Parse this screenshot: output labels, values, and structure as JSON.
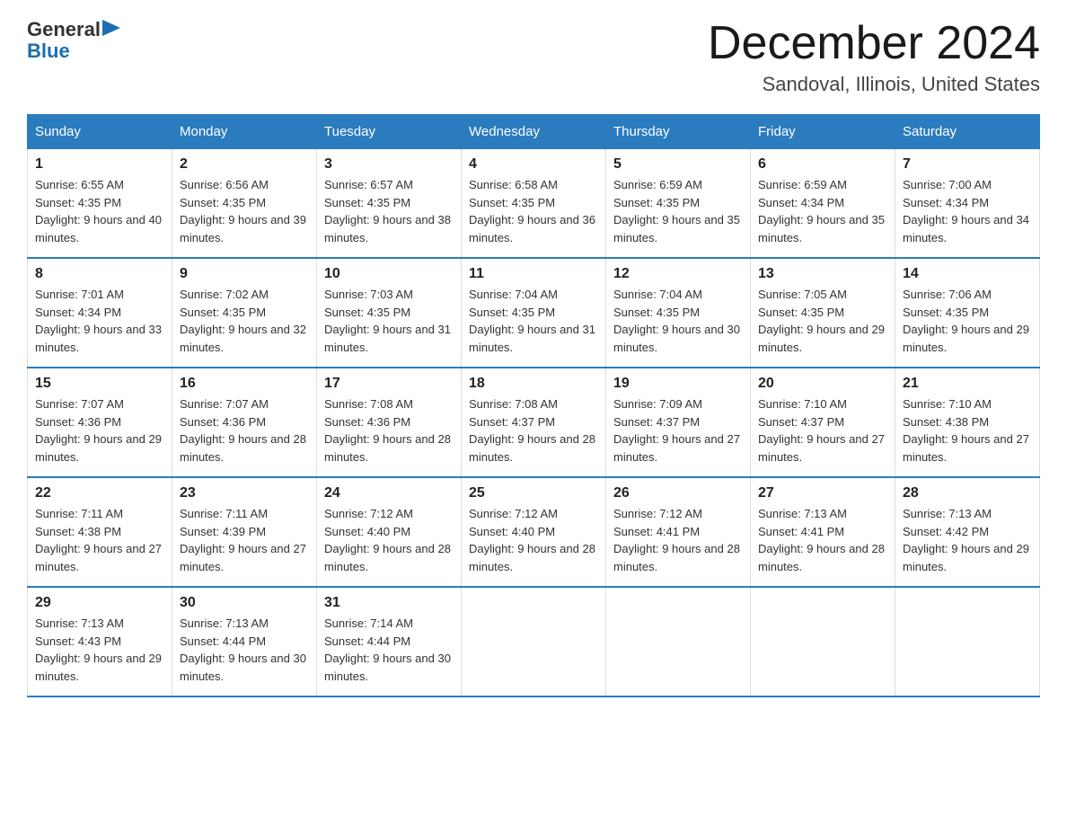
{
  "header": {
    "logo": {
      "general": "General",
      "blue": "Blue",
      "arrow": "▶"
    },
    "title": "December 2024",
    "subtitle": "Sandoval, Illinois, United States"
  },
  "days_of_week": [
    "Sunday",
    "Monday",
    "Tuesday",
    "Wednesday",
    "Thursday",
    "Friday",
    "Saturday"
  ],
  "weeks": [
    [
      {
        "day": "1",
        "sunrise": "6:55 AM",
        "sunset": "4:35 PM",
        "daylight": "9 hours and 40 minutes."
      },
      {
        "day": "2",
        "sunrise": "6:56 AM",
        "sunset": "4:35 PM",
        "daylight": "9 hours and 39 minutes."
      },
      {
        "day": "3",
        "sunrise": "6:57 AM",
        "sunset": "4:35 PM",
        "daylight": "9 hours and 38 minutes."
      },
      {
        "day": "4",
        "sunrise": "6:58 AM",
        "sunset": "4:35 PM",
        "daylight": "9 hours and 36 minutes."
      },
      {
        "day": "5",
        "sunrise": "6:59 AM",
        "sunset": "4:35 PM",
        "daylight": "9 hours and 35 minutes."
      },
      {
        "day": "6",
        "sunrise": "6:59 AM",
        "sunset": "4:34 PM",
        "daylight": "9 hours and 35 minutes."
      },
      {
        "day": "7",
        "sunrise": "7:00 AM",
        "sunset": "4:34 PM",
        "daylight": "9 hours and 34 minutes."
      }
    ],
    [
      {
        "day": "8",
        "sunrise": "7:01 AM",
        "sunset": "4:34 PM",
        "daylight": "9 hours and 33 minutes."
      },
      {
        "day": "9",
        "sunrise": "7:02 AM",
        "sunset": "4:35 PM",
        "daylight": "9 hours and 32 minutes."
      },
      {
        "day": "10",
        "sunrise": "7:03 AM",
        "sunset": "4:35 PM",
        "daylight": "9 hours and 31 minutes."
      },
      {
        "day": "11",
        "sunrise": "7:04 AM",
        "sunset": "4:35 PM",
        "daylight": "9 hours and 31 minutes."
      },
      {
        "day": "12",
        "sunrise": "7:04 AM",
        "sunset": "4:35 PM",
        "daylight": "9 hours and 30 minutes."
      },
      {
        "day": "13",
        "sunrise": "7:05 AM",
        "sunset": "4:35 PM",
        "daylight": "9 hours and 29 minutes."
      },
      {
        "day": "14",
        "sunrise": "7:06 AM",
        "sunset": "4:35 PM",
        "daylight": "9 hours and 29 minutes."
      }
    ],
    [
      {
        "day": "15",
        "sunrise": "7:07 AM",
        "sunset": "4:36 PM",
        "daylight": "9 hours and 29 minutes."
      },
      {
        "day": "16",
        "sunrise": "7:07 AM",
        "sunset": "4:36 PM",
        "daylight": "9 hours and 28 minutes."
      },
      {
        "day": "17",
        "sunrise": "7:08 AM",
        "sunset": "4:36 PM",
        "daylight": "9 hours and 28 minutes."
      },
      {
        "day": "18",
        "sunrise": "7:08 AM",
        "sunset": "4:37 PM",
        "daylight": "9 hours and 28 minutes."
      },
      {
        "day": "19",
        "sunrise": "7:09 AM",
        "sunset": "4:37 PM",
        "daylight": "9 hours and 27 minutes."
      },
      {
        "day": "20",
        "sunrise": "7:10 AM",
        "sunset": "4:37 PM",
        "daylight": "9 hours and 27 minutes."
      },
      {
        "day": "21",
        "sunrise": "7:10 AM",
        "sunset": "4:38 PM",
        "daylight": "9 hours and 27 minutes."
      }
    ],
    [
      {
        "day": "22",
        "sunrise": "7:11 AM",
        "sunset": "4:38 PM",
        "daylight": "9 hours and 27 minutes."
      },
      {
        "day": "23",
        "sunrise": "7:11 AM",
        "sunset": "4:39 PM",
        "daylight": "9 hours and 27 minutes."
      },
      {
        "day": "24",
        "sunrise": "7:12 AM",
        "sunset": "4:40 PM",
        "daylight": "9 hours and 28 minutes."
      },
      {
        "day": "25",
        "sunrise": "7:12 AM",
        "sunset": "4:40 PM",
        "daylight": "9 hours and 28 minutes."
      },
      {
        "day": "26",
        "sunrise": "7:12 AM",
        "sunset": "4:41 PM",
        "daylight": "9 hours and 28 minutes."
      },
      {
        "day": "27",
        "sunrise": "7:13 AM",
        "sunset": "4:41 PM",
        "daylight": "9 hours and 28 minutes."
      },
      {
        "day": "28",
        "sunrise": "7:13 AM",
        "sunset": "4:42 PM",
        "daylight": "9 hours and 29 minutes."
      }
    ],
    [
      {
        "day": "29",
        "sunrise": "7:13 AM",
        "sunset": "4:43 PM",
        "daylight": "9 hours and 29 minutes."
      },
      {
        "day": "30",
        "sunrise": "7:13 AM",
        "sunset": "4:44 PM",
        "daylight": "9 hours and 30 minutes."
      },
      {
        "day": "31",
        "sunrise": "7:14 AM",
        "sunset": "4:44 PM",
        "daylight": "9 hours and 30 minutes."
      },
      null,
      null,
      null,
      null
    ]
  ]
}
